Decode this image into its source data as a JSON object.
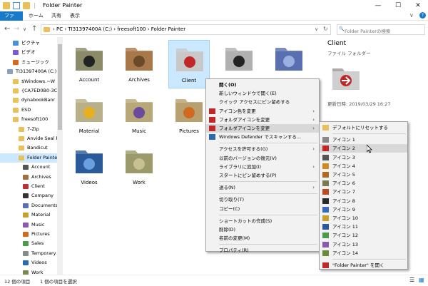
{
  "window": {
    "title": "Folder Painter",
    "qat_separator": "|",
    "min": "—",
    "max": "☐",
    "close": "✕"
  },
  "ribbon": {
    "tabs": [
      "ファイル",
      "ホーム",
      "共有",
      "表示"
    ],
    "chevron": "∨",
    "help": "?"
  },
  "address": {
    "back": "←",
    "forward": "→",
    "dropdown": "∨",
    "up": "↑",
    "path": "›  PC  ›  TI31397400A (C:)  ›  freesoft100  ›  Folder Painter",
    "path_dropdown": "∨",
    "refresh": "↻",
    "search_placeholder": "Folder Painterの検索",
    "search_icon": "🔍"
  },
  "nav": [
    {
      "label": "ピクチャ",
      "indent": 30,
      "icon": "#4a90d9"
    },
    {
      "label": "ビデオ",
      "indent": 30,
      "icon": "#7a5bd0"
    },
    {
      "label": "ミュージック",
      "indent": 30,
      "icon": "#d86a1f"
    },
    {
      "label": "TI31397400A (C:)",
      "indent": 22,
      "icon": "#8aa0b8"
    },
    {
      "label": "$Windows.~W",
      "indent": 30,
      "icon": "#e8c15a"
    },
    {
      "label": "{CA7ED0B0-3C",
      "indent": 30,
      "icon": "#e8c15a"
    },
    {
      "label": "dynabookBanr",
      "indent": 30,
      "icon": "#e8c15a"
    },
    {
      "label": "ESD",
      "indent": 30,
      "icon": "#e8c15a"
    },
    {
      "label": "freesoft100",
      "indent": 30,
      "icon": "#e8c15a"
    },
    {
      "label": "7-Zip",
      "indent": 38,
      "icon": "#e8c15a"
    },
    {
      "label": "Anvide Seal F",
      "indent": 38,
      "icon": "#e8c15a"
    },
    {
      "label": "Bandicut",
      "indent": 38,
      "icon": "#e8c15a"
    },
    {
      "label": "Folder Painte",
      "indent": 38,
      "icon": "#e8c15a",
      "selected": true
    },
    {
      "label": "Account",
      "indent": 44,
      "icon": "#555"
    },
    {
      "label": "Archives",
      "indent": 44,
      "icon": "#a07040"
    },
    {
      "label": "Client",
      "indent": 44,
      "icon": "#c03030"
    },
    {
      "label": "Company",
      "indent": 44,
      "icon": "#333"
    },
    {
      "label": "Documents",
      "indent": 44,
      "icon": "#5a6fb0"
    },
    {
      "label": "Material",
      "indent": 44,
      "icon": "#c8a030"
    },
    {
      "label": "Music",
      "indent": 44,
      "icon": "#8a5ab0"
    },
    {
      "label": "Pictures",
      "indent": 44,
      "icon": "#d06a20"
    },
    {
      "label": "Sales",
      "indent": 44,
      "icon": "#4a9a4a"
    },
    {
      "label": "Temporary",
      "indent": 44,
      "icon": "#888"
    },
    {
      "label": "Videos",
      "indent": 44,
      "icon": "#2a6ab0"
    },
    {
      "label": "Work",
      "indent": 44,
      "icon": "#7a8a4a"
    }
  ],
  "folders": [
    {
      "label": "Account",
      "color": "#8b8b6a",
      "emblem": "#222"
    },
    {
      "label": "Archives",
      "color": "#a8784a",
      "emblem": "#6b4a2a"
    },
    {
      "label": "Client",
      "color": "#c8c8c8",
      "emblem": "#c02828",
      "selected": true
    },
    {
      "label": "",
      "color": "#b0b0b0",
      "emblem": "#222"
    },
    {
      "label": "",
      "color": "#5a6fb0",
      "emblem": "#9ab0e0"
    },
    {
      "label": "Material",
      "color": "#b8b088",
      "emblem": "#e8b020"
    },
    {
      "label": "Music",
      "color": "#b8a878",
      "emblem": "#6a4a9a"
    },
    {
      "label": "Pictures",
      "color": "#b8a070",
      "emblem": "#d06a20"
    },
    {
      "label": "Videos",
      "color": "#2a5a9a",
      "emblem": "#6aa0e0"
    },
    {
      "label": "Work",
      "color": "#9a9a6a",
      "emblem": "#c8c090"
    }
  ],
  "preview": {
    "name": "Client",
    "type": "ファイル フォルダー",
    "date": "更新日時:  2019/03/29 16:27"
  },
  "context_menu": [
    {
      "label": "開く(O)",
      "bold": true
    },
    {
      "label": "新しいウィンドウで開く(E)"
    },
    {
      "label": "クイック アクセスにピン留めする"
    },
    {
      "label": "アイコン色を変更",
      "icon": "#c02828",
      "arrow": "›"
    },
    {
      "label": "フォルダアイコンを変更",
      "icon": "#c02828",
      "arrow": "›"
    },
    {
      "label": "フォルダアイコンを変更",
      "icon": "#c02828",
      "arrow": "›",
      "highlight": true
    },
    {
      "label": "Windows Defender でスキャンする...",
      "icon": "#2a6ab0"
    },
    {
      "sep": true
    },
    {
      "label": "アクセスを許可する(G)",
      "arrow": "›"
    },
    {
      "label": "以前のバージョンの復元(V)"
    },
    {
      "label": "ライブラリに追加(I)",
      "arrow": "›"
    },
    {
      "label": "スタートにピン留めする(P)"
    },
    {
      "sep": true
    },
    {
      "label": "送る(N)",
      "arrow": "›"
    },
    {
      "sep": true
    },
    {
      "label": "切り取り(T)"
    },
    {
      "label": "コピー(C)"
    },
    {
      "sep": true
    },
    {
      "label": "ショートカットの作成(S)"
    },
    {
      "label": "削除(D)"
    },
    {
      "label": "名前の変更(M)"
    },
    {
      "sep": true
    },
    {
      "label": "プロパティ(R)"
    }
  ],
  "submenu": [
    {
      "label": "デフォルトにリセットする",
      "icon": "#e8c15a"
    },
    {
      "sep": true
    },
    {
      "label": "アイコン 1",
      "icon": "#888"
    },
    {
      "label": "アイコン 2",
      "icon": "#c02828",
      "highlight": true
    },
    {
      "label": "アイコン 3",
      "icon": "#555"
    },
    {
      "label": "アイコン 4",
      "icon": "#d08a20"
    },
    {
      "label": "アイコン 5",
      "icon": "#b06a20"
    },
    {
      "label": "アイコン 6",
      "icon": "#7a7a4a"
    },
    {
      "label": "アイコン 7",
      "icon": "#c04a20"
    },
    {
      "label": "アイコン 8",
      "icon": "#2a2a2a"
    },
    {
      "label": "アイコン 9",
      "icon": "#3a6ac0"
    },
    {
      "label": "アイコン 10",
      "icon": "#c8a030"
    },
    {
      "label": "アイコン 11",
      "icon": "#2a5a9a"
    },
    {
      "label": "アイコン 12",
      "icon": "#4a9a4a"
    },
    {
      "label": "アイコン 13",
      "icon": "#8a5ab0"
    },
    {
      "label": "アイコン 14",
      "icon": "#6a8a3a"
    },
    {
      "sep": true
    },
    {
      "label": "\"Folder Painter\" を開く",
      "icon": "#c02828"
    }
  ],
  "status": {
    "count": "12 個の項目",
    "selected": "1 個の項目を選択",
    "view_details": "☰",
    "view_icons": "▦"
  }
}
